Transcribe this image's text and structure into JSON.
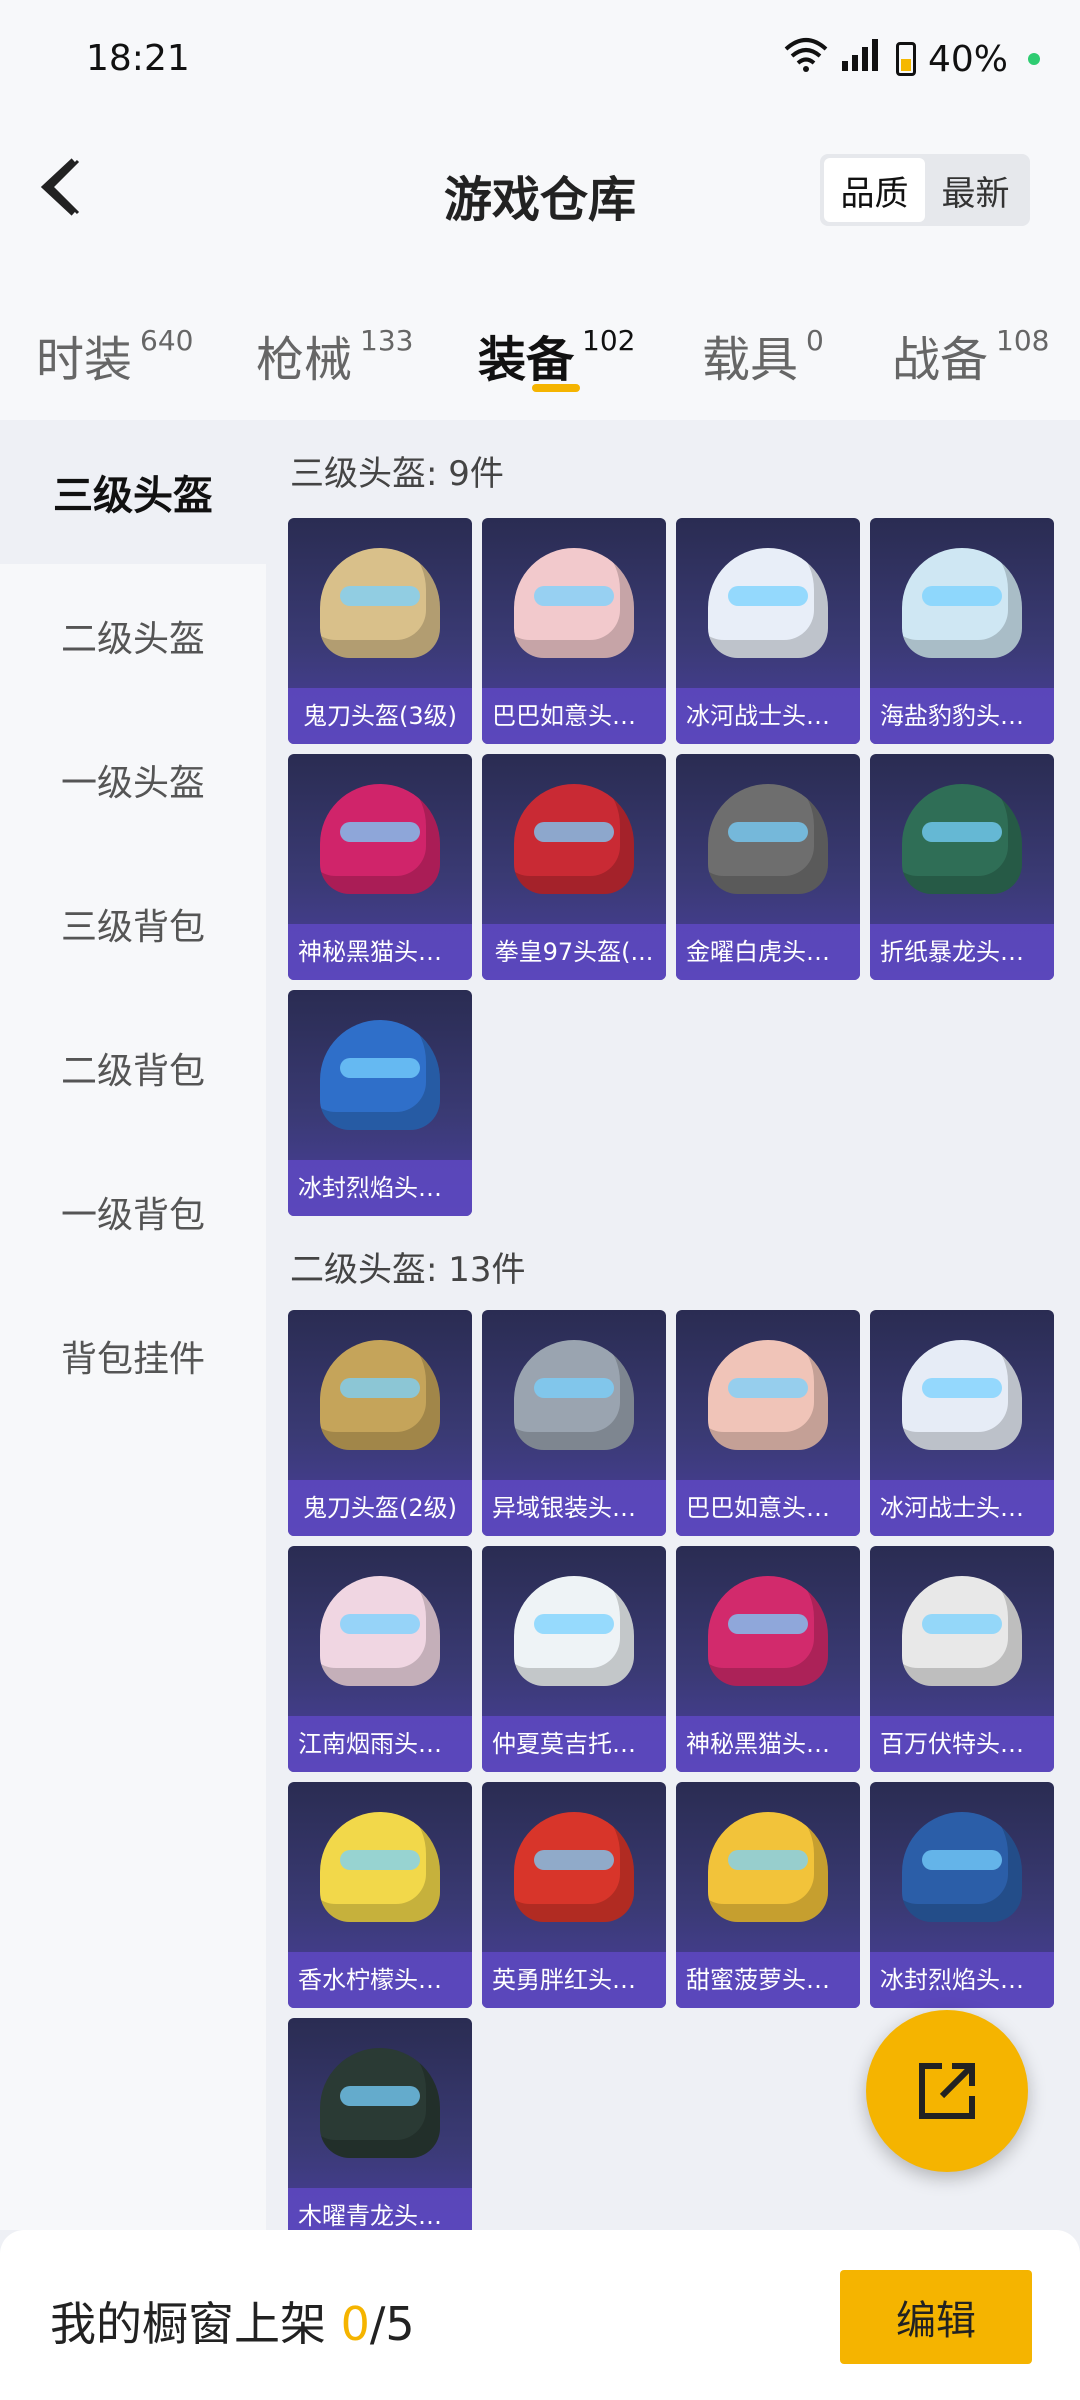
{
  "status_bar": {
    "time": "18:21",
    "network": "4G",
    "battery": "40%"
  },
  "header": {
    "title": "游戏仓库",
    "sort_options": [
      "品质",
      "最新"
    ],
    "sort_active": "品质"
  },
  "tabs": [
    {
      "label": "时装",
      "count": "640"
    },
    {
      "label": "枪械",
      "count": "133"
    },
    {
      "label": "装备",
      "count": "102"
    },
    {
      "label": "载具",
      "count": "0"
    },
    {
      "label": "战备",
      "count": "108"
    }
  ],
  "sidebar": {
    "items": [
      "三级头盔",
      "二级头盔",
      "一级头盔",
      "三级背包",
      "二级背包",
      "一级背包",
      "背包挂件"
    ]
  },
  "sections": [
    {
      "title": "三级头盔: 9件",
      "items": [
        {
          "name": "鬼刀头盔(3级)",
          "color": "#d9c08a"
        },
        {
          "name": "巴巴如意头盔...",
          "color": "#f2c9cc"
        },
        {
          "name": "冰河战士头盔...",
          "color": "#e8eef8"
        },
        {
          "name": "海盐豹豹头盔...",
          "color": "#cfe7f3"
        },
        {
          "name": "神秘黑猫头盔...",
          "color": "#d0246a"
        },
        {
          "name": "拳皇97头盔(...",
          "color": "#c92a34"
        },
        {
          "name": "金曜白虎头盔...",
          "color": "#6e6e6e"
        },
        {
          "name": "折纸暴龙头盔...",
          "color": "#2f6e56"
        },
        {
          "name": "冰封烈焰头盔...",
          "color": "#2f6fc9"
        }
      ]
    },
    {
      "title": "二级头盔: 13件",
      "items": [
        {
          "name": "鬼刀头盔(2级)",
          "color": "#c5a45a"
        },
        {
          "name": "异域银装头盔...",
          "color": "#9aa4b0"
        },
        {
          "name": "巴巴如意头盔...",
          "color": "#f0c4b8"
        },
        {
          "name": "冰河战士头盔...",
          "color": "#e6ecf6"
        },
        {
          "name": "江南烟雨头盔...",
          "color": "#f0d6e2"
        },
        {
          "name": "仲夏莫吉托头...",
          "color": "#eef3f6"
        },
        {
          "name": "神秘黑猫头盔...",
          "color": "#d22a6c"
        },
        {
          "name": "百万伏特头盔...",
          "color": "#e8e8e8"
        },
        {
          "name": "香水柠檬头盔...",
          "color": "#f2d84a"
        },
        {
          "name": "英勇胖红头盔...",
          "color": "#d8352a"
        },
        {
          "name": "甜蜜菠萝头盔...",
          "color": "#f2c33a"
        },
        {
          "name": "冰封烈焰头盔...",
          "color": "#2b5ea8"
        },
        {
          "name": "木曜青龙头盔...",
          "color": "#2a3a34"
        }
      ]
    }
  ],
  "bottom_bar": {
    "label": "我的橱窗上架 ",
    "count": "0",
    "total": "/5",
    "edit_label": "编辑"
  },
  "accent_color": "#f5b400"
}
